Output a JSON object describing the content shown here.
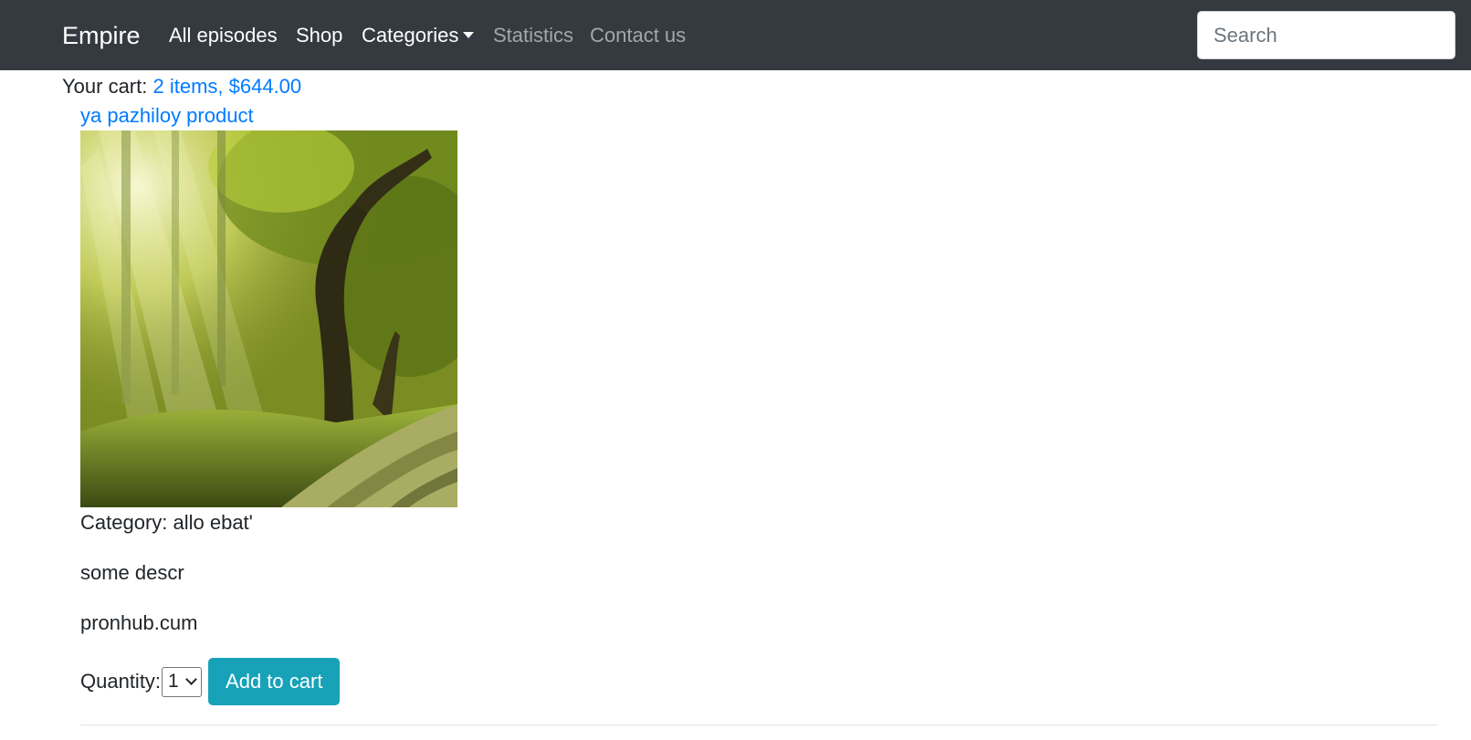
{
  "navbar": {
    "brand": "Empire",
    "items": [
      {
        "label": "All episodes",
        "state": "active"
      },
      {
        "label": "Shop",
        "state": "active"
      },
      {
        "label": "Categories",
        "state": "active",
        "dropdown": true
      },
      {
        "label": "Statistics",
        "state": "muted"
      },
      {
        "label": "Contact us",
        "state": "muted"
      }
    ],
    "search_placeholder": "Search",
    "background_color": "#343a40"
  },
  "cart": {
    "label": "Your cart:",
    "summary": "2 items, $644.00"
  },
  "product": {
    "title": "ya pazhiloy product",
    "image_description": "sunlit forest road",
    "category_line": "Category: allo ebat'",
    "description": "some descr",
    "link_text": "pronhub.cum",
    "quantity_label": "Quantity:",
    "quantity_value": "1",
    "add_button_label": "Add to cart",
    "button_color": "#17a2b8",
    "link_color": "#007bff"
  }
}
